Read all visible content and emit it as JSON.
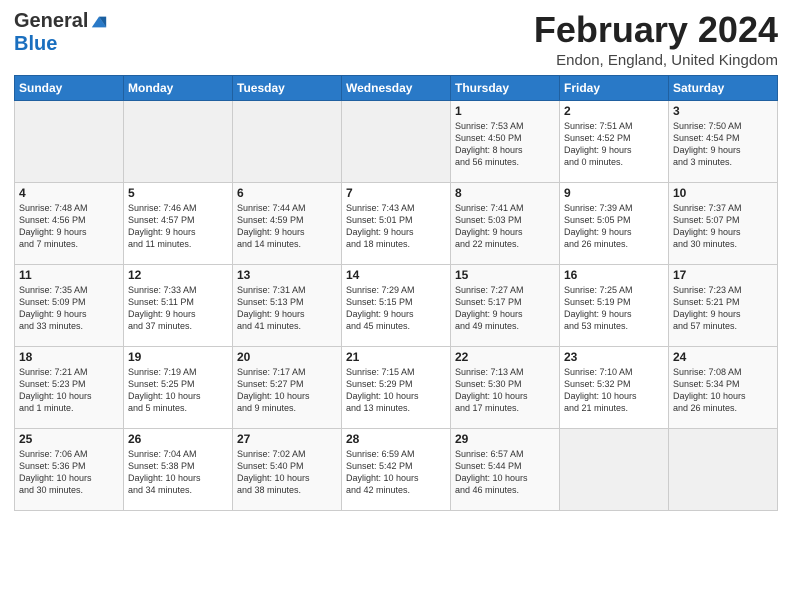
{
  "header": {
    "logo_general": "General",
    "logo_blue": "Blue",
    "month_title": "February 2024",
    "location": "Endon, England, United Kingdom"
  },
  "days_of_week": [
    "Sunday",
    "Monday",
    "Tuesday",
    "Wednesday",
    "Thursday",
    "Friday",
    "Saturday"
  ],
  "weeks": [
    [
      {
        "day": "",
        "info": ""
      },
      {
        "day": "",
        "info": ""
      },
      {
        "day": "",
        "info": ""
      },
      {
        "day": "",
        "info": ""
      },
      {
        "day": "1",
        "info": "Sunrise: 7:53 AM\nSunset: 4:50 PM\nDaylight: 8 hours\nand 56 minutes."
      },
      {
        "day": "2",
        "info": "Sunrise: 7:51 AM\nSunset: 4:52 PM\nDaylight: 9 hours\nand 0 minutes."
      },
      {
        "day": "3",
        "info": "Sunrise: 7:50 AM\nSunset: 4:54 PM\nDaylight: 9 hours\nand 3 minutes."
      }
    ],
    [
      {
        "day": "4",
        "info": "Sunrise: 7:48 AM\nSunset: 4:56 PM\nDaylight: 9 hours\nand 7 minutes."
      },
      {
        "day": "5",
        "info": "Sunrise: 7:46 AM\nSunset: 4:57 PM\nDaylight: 9 hours\nand 11 minutes."
      },
      {
        "day": "6",
        "info": "Sunrise: 7:44 AM\nSunset: 4:59 PM\nDaylight: 9 hours\nand 14 minutes."
      },
      {
        "day": "7",
        "info": "Sunrise: 7:43 AM\nSunset: 5:01 PM\nDaylight: 9 hours\nand 18 minutes."
      },
      {
        "day": "8",
        "info": "Sunrise: 7:41 AM\nSunset: 5:03 PM\nDaylight: 9 hours\nand 22 minutes."
      },
      {
        "day": "9",
        "info": "Sunrise: 7:39 AM\nSunset: 5:05 PM\nDaylight: 9 hours\nand 26 minutes."
      },
      {
        "day": "10",
        "info": "Sunrise: 7:37 AM\nSunset: 5:07 PM\nDaylight: 9 hours\nand 30 minutes."
      }
    ],
    [
      {
        "day": "11",
        "info": "Sunrise: 7:35 AM\nSunset: 5:09 PM\nDaylight: 9 hours\nand 33 minutes."
      },
      {
        "day": "12",
        "info": "Sunrise: 7:33 AM\nSunset: 5:11 PM\nDaylight: 9 hours\nand 37 minutes."
      },
      {
        "day": "13",
        "info": "Sunrise: 7:31 AM\nSunset: 5:13 PM\nDaylight: 9 hours\nand 41 minutes."
      },
      {
        "day": "14",
        "info": "Sunrise: 7:29 AM\nSunset: 5:15 PM\nDaylight: 9 hours\nand 45 minutes."
      },
      {
        "day": "15",
        "info": "Sunrise: 7:27 AM\nSunset: 5:17 PM\nDaylight: 9 hours\nand 49 minutes."
      },
      {
        "day": "16",
        "info": "Sunrise: 7:25 AM\nSunset: 5:19 PM\nDaylight: 9 hours\nand 53 minutes."
      },
      {
        "day": "17",
        "info": "Sunrise: 7:23 AM\nSunset: 5:21 PM\nDaylight: 9 hours\nand 57 minutes."
      }
    ],
    [
      {
        "day": "18",
        "info": "Sunrise: 7:21 AM\nSunset: 5:23 PM\nDaylight: 10 hours\nand 1 minute."
      },
      {
        "day": "19",
        "info": "Sunrise: 7:19 AM\nSunset: 5:25 PM\nDaylight: 10 hours\nand 5 minutes."
      },
      {
        "day": "20",
        "info": "Sunrise: 7:17 AM\nSunset: 5:27 PM\nDaylight: 10 hours\nand 9 minutes."
      },
      {
        "day": "21",
        "info": "Sunrise: 7:15 AM\nSunset: 5:29 PM\nDaylight: 10 hours\nand 13 minutes."
      },
      {
        "day": "22",
        "info": "Sunrise: 7:13 AM\nSunset: 5:30 PM\nDaylight: 10 hours\nand 17 minutes."
      },
      {
        "day": "23",
        "info": "Sunrise: 7:10 AM\nSunset: 5:32 PM\nDaylight: 10 hours\nand 21 minutes."
      },
      {
        "day": "24",
        "info": "Sunrise: 7:08 AM\nSunset: 5:34 PM\nDaylight: 10 hours\nand 26 minutes."
      }
    ],
    [
      {
        "day": "25",
        "info": "Sunrise: 7:06 AM\nSunset: 5:36 PM\nDaylight: 10 hours\nand 30 minutes."
      },
      {
        "day": "26",
        "info": "Sunrise: 7:04 AM\nSunset: 5:38 PM\nDaylight: 10 hours\nand 34 minutes."
      },
      {
        "day": "27",
        "info": "Sunrise: 7:02 AM\nSunset: 5:40 PM\nDaylight: 10 hours\nand 38 minutes."
      },
      {
        "day": "28",
        "info": "Sunrise: 6:59 AM\nSunset: 5:42 PM\nDaylight: 10 hours\nand 42 minutes."
      },
      {
        "day": "29",
        "info": "Sunrise: 6:57 AM\nSunset: 5:44 PM\nDaylight: 10 hours\nand 46 minutes."
      },
      {
        "day": "",
        "info": ""
      },
      {
        "day": "",
        "info": ""
      }
    ]
  ]
}
